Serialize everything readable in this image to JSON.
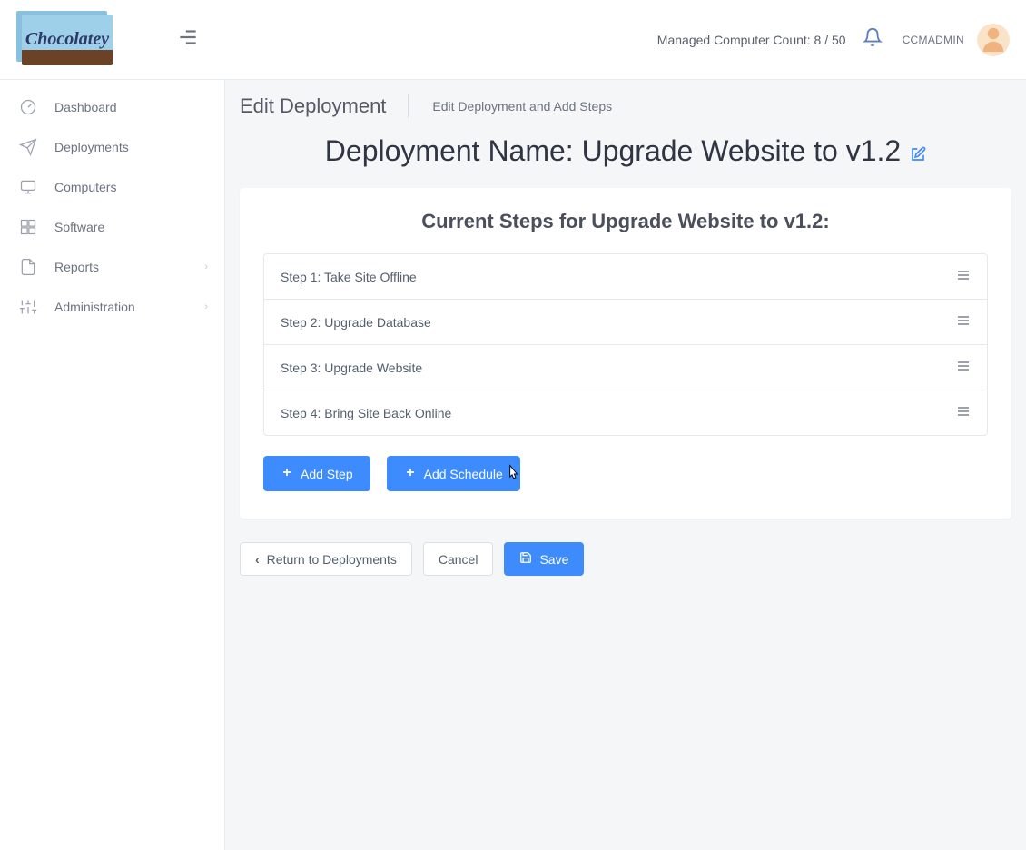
{
  "header": {
    "logo_text": "Chocolatey",
    "computer_count_text": "Managed Computer Count: 8 / 50",
    "username": "CCMADMIN"
  },
  "sidebar": {
    "items": [
      {
        "label": "Dashboard",
        "icon": "dashboard",
        "expandable": false
      },
      {
        "label": "Deployments",
        "icon": "send",
        "expandable": false
      },
      {
        "label": "Computers",
        "icon": "monitor",
        "expandable": false
      },
      {
        "label": "Software",
        "icon": "grid",
        "expandable": false
      },
      {
        "label": "Reports",
        "icon": "file",
        "expandable": true
      },
      {
        "label": "Administration",
        "icon": "sliders",
        "expandable": true
      }
    ]
  },
  "breadcrumb": {
    "title": "Edit Deployment",
    "subtitle": "Edit Deployment and Add Steps"
  },
  "deployment": {
    "name_prefix": "Deployment Name: ",
    "name": "Upgrade Website to v1.2",
    "steps_heading_prefix": "Current Steps for ",
    "steps_heading_suffix": ":",
    "steps": [
      {
        "label": "Step 1: Take Site Offline"
      },
      {
        "label": "Step 2: Upgrade Database"
      },
      {
        "label": "Step 3: Upgrade Website"
      },
      {
        "label": "Step 4: Bring Site Back Online"
      }
    ]
  },
  "buttons": {
    "add_step": "Add Step",
    "add_schedule": "Add Schedule",
    "return": "Return to Deployments",
    "cancel": "Cancel",
    "save": "Save"
  }
}
